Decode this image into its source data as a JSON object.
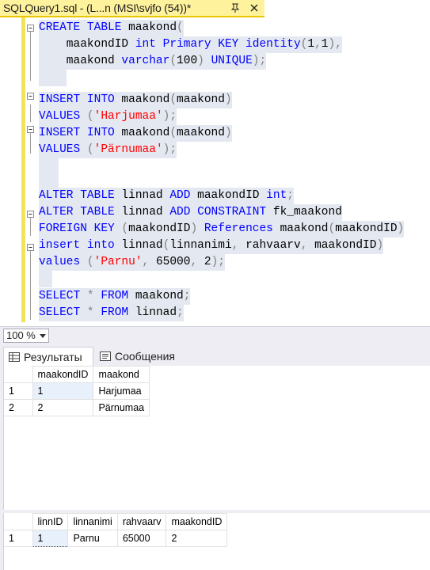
{
  "tab": {
    "title": "SQLQuery1.sql - (L...n (MSI\\svjfo (54))*"
  },
  "code": [
    [
      [
        "kw",
        "CREATE TABLE "
      ],
      [
        "obj",
        "maakond"
      ],
      [
        "gray",
        "("
      ]
    ],
    [
      [
        "obj",
        "    maakondID "
      ],
      [
        "tp",
        "int "
      ],
      [
        "kw",
        "Primary KEY identity"
      ],
      [
        "gray",
        "("
      ],
      [
        "obj",
        "1"
      ],
      [
        "gray",
        ","
      ],
      [
        "obj",
        "1"
      ],
      [
        "gray",
        "),"
      ]
    ],
    [
      [
        "obj",
        "    maakond "
      ],
      [
        "tp",
        "varchar"
      ],
      [
        "gray",
        "("
      ],
      [
        "obj",
        "100"
      ],
      [
        "gray",
        ") "
      ],
      [
        "kw",
        "UNIQUE"
      ],
      [
        "gray",
        ");"
      ]
    ],
    [
      [
        "obj",
        "    "
      ]
    ],
    [
      [
        "kw",
        "INSERT INTO "
      ],
      [
        "obj",
        "maakond"
      ],
      [
        "gray",
        "("
      ],
      [
        "obj",
        "maakond"
      ],
      [
        "gray",
        ")"
      ]
    ],
    [
      [
        "kw",
        "VALUES "
      ],
      [
        "gray",
        "("
      ],
      [
        "str",
        "'Harjumaa'"
      ],
      [
        "gray",
        ");"
      ]
    ],
    [
      [
        "kw",
        "INSERT INTO "
      ],
      [
        "obj",
        "maakond"
      ],
      [
        "gray",
        "("
      ],
      [
        "obj",
        "maakond"
      ],
      [
        "gray",
        ")"
      ]
    ],
    [
      [
        "kw",
        "VALUES "
      ],
      [
        "gray",
        "("
      ],
      [
        "str",
        "'Pärnumaa'"
      ],
      [
        "gray",
        ");"
      ]
    ],
    [
      [
        "obj",
        "  "
      ]
    ],
    [
      [
        "obj",
        "  "
      ]
    ],
    [
      [
        "kw",
        "ALTER TABLE "
      ],
      [
        "obj",
        "linnad "
      ],
      [
        "kw",
        "ADD "
      ],
      [
        "obj",
        "maakondID "
      ],
      [
        "tp",
        "int"
      ],
      [
        "gray",
        ";"
      ]
    ],
    [
      [
        "kw",
        "ALTER TABLE "
      ],
      [
        "obj",
        "linnad "
      ],
      [
        "kw",
        "ADD CONSTRAINT "
      ],
      [
        "obj",
        "fk_maakond"
      ]
    ],
    [
      [
        "kw",
        "FOREIGN KEY "
      ],
      [
        "gray",
        "("
      ],
      [
        "obj",
        "maakondID"
      ],
      [
        "gray",
        ") "
      ],
      [
        "kw",
        "References "
      ],
      [
        "obj",
        "maakond"
      ],
      [
        "gray",
        "("
      ],
      [
        "obj",
        "maakondID"
      ],
      [
        "gray",
        ")"
      ]
    ],
    [
      [
        "kw",
        "insert into "
      ],
      [
        "obj",
        "linnad"
      ],
      [
        "gray",
        "("
      ],
      [
        "obj",
        "linnanimi"
      ],
      [
        "gray",
        ", "
      ],
      [
        "obj",
        "rahvaarv"
      ],
      [
        "gray",
        ", "
      ],
      [
        "obj",
        "maakondID"
      ],
      [
        "gray",
        ")"
      ]
    ],
    [
      [
        "kw",
        "values "
      ],
      [
        "gray",
        "("
      ],
      [
        "str",
        "'Parnu'"
      ],
      [
        "gray",
        ", "
      ],
      [
        "obj",
        "65000"
      ],
      [
        "gray",
        ", "
      ],
      [
        "obj",
        "2"
      ],
      [
        "gray",
        ");"
      ]
    ],
    [
      [
        "obj",
        "  "
      ]
    ],
    [
      [
        "kw",
        "SELECT "
      ],
      [
        "gray",
        "* "
      ],
      [
        "kw",
        "FROM "
      ],
      [
        "obj",
        "maakond"
      ],
      [
        "gray",
        ";"
      ]
    ],
    [
      [
        "kw",
        "SELECT "
      ],
      [
        "gray",
        "* "
      ],
      [
        "kw",
        "FROM "
      ],
      [
        "obj",
        "linnad"
      ],
      [
        "gray",
        ";"
      ]
    ]
  ],
  "zoom": {
    "value": "100 %"
  },
  "result_tabs": {
    "results": "Результаты",
    "messages": "Сообщения"
  },
  "grid1": {
    "columns": [
      "maakondID",
      "maakond"
    ],
    "rows": [
      [
        "1",
        "1",
        "Harjumaa"
      ],
      [
        "2",
        "2",
        "Pärnumaa"
      ]
    ]
  },
  "grid2": {
    "columns": [
      "linnID",
      "linnanimi",
      "rahvaarv",
      "maakondID"
    ],
    "rows": [
      [
        "1",
        "1",
        "Parnu",
        "65000",
        "2"
      ]
    ]
  }
}
